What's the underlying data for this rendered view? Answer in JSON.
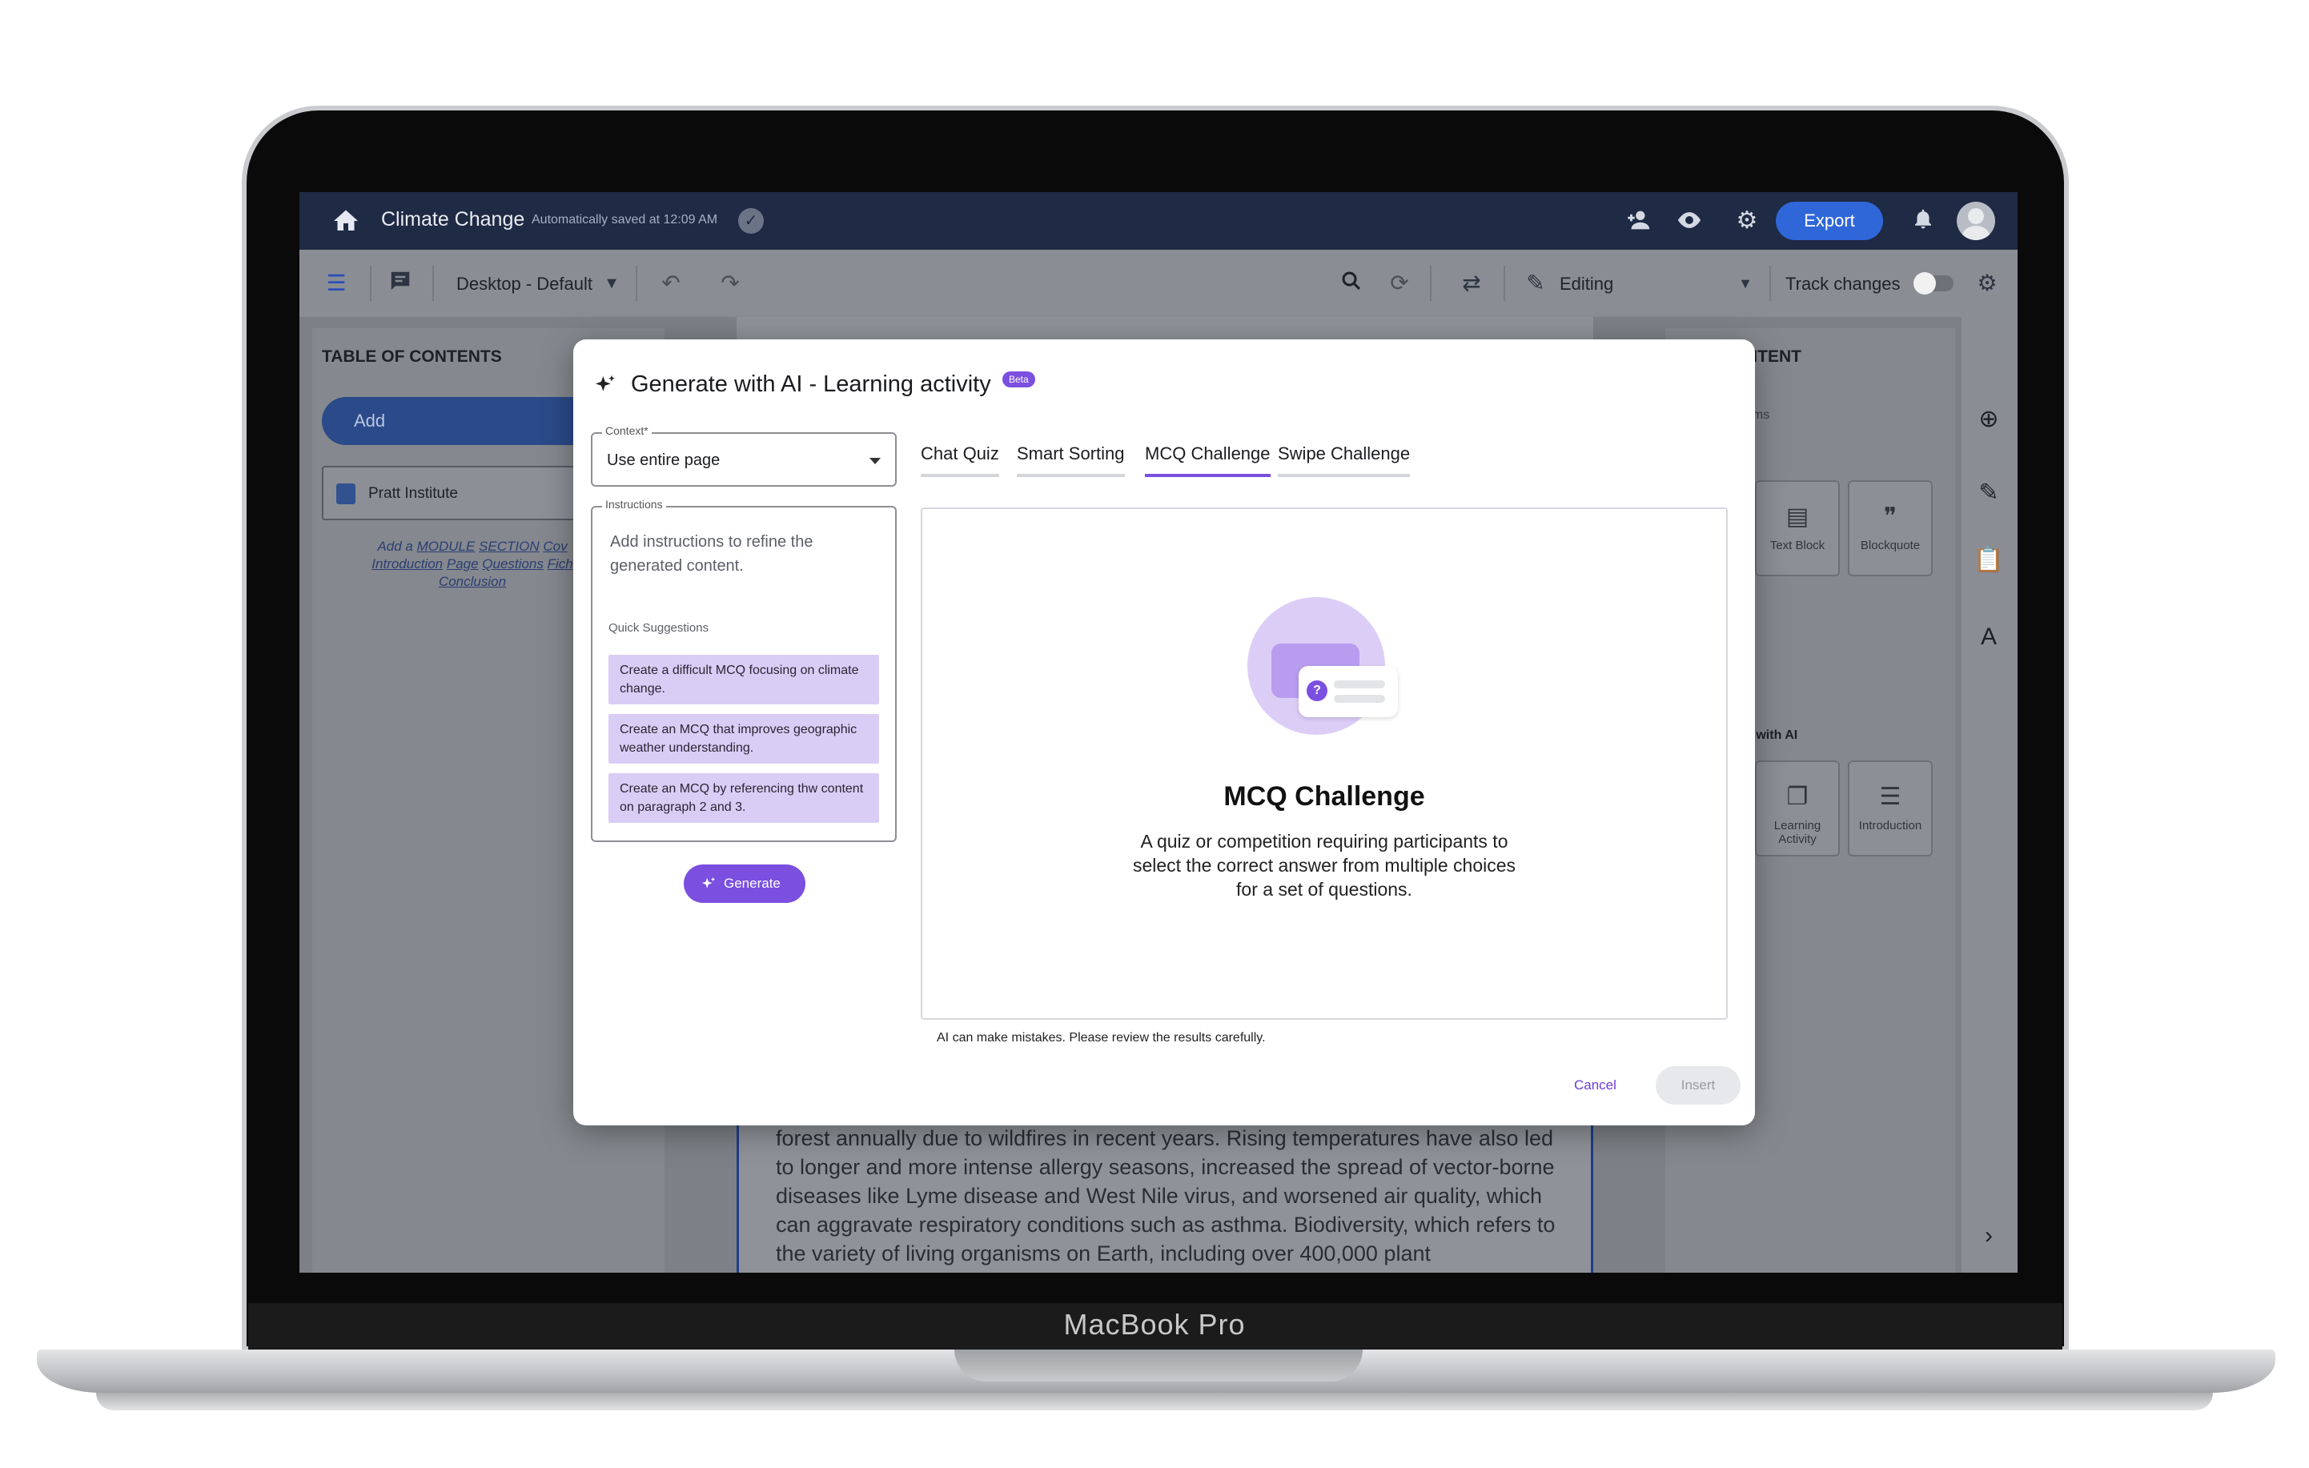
{
  "device": {
    "brand": "MacBook Pro"
  },
  "app": {
    "title": "Climate Change",
    "saved_status": "Automatically saved at 12:09 AM",
    "export_label": "Export"
  },
  "toolbar": {
    "view_mode": "Desktop - Default",
    "mode": "Editing",
    "track_changes_label": "Track changes"
  },
  "toc": {
    "heading": "TABLE OF CONTENTS",
    "add_label": "Add",
    "item_label": "Pratt Institute",
    "hint_prefix": "Add a",
    "hint_links": [
      "MODULE",
      "SECTION",
      "Cov",
      "Introduction",
      "Page",
      "Questions",
      "Fich",
      "Conclusion"
    ]
  },
  "document": {
    "visible_text": "Glacier National Park since 1850, and the U.S. has lost nearly 3 million acres of forest annually due to wildfires in recent years. Rising temperatures have also led to longer and more intense allergy seasons, increased the spread of vector-borne diseases like Lyme disease and West Nile virus, and worsened air quality, which can aggravate respiratory conditions such as asthma. Biodiversity, which refers to the variety of living organisms on Earth, including over 400,000 plant"
  },
  "right_panel": {
    "heading_partial": "NTENT",
    "search_placeholder_partial": "ems",
    "tiles_top": [
      "Text Block",
      "Blockquote"
    ],
    "ai_section_partial": "e with AI",
    "tiles_ai": [
      "Learning Activity",
      "Introduction"
    ]
  },
  "modal": {
    "title": "Generate with AI - Learning activity",
    "badge": "Beta",
    "context": {
      "label": "Context*",
      "value": "Use entire page"
    },
    "instructions": {
      "label": "Instructions",
      "placeholder": "Add instructions to refine the generated content.",
      "quick_suggestions_label": "Quick Suggestions",
      "suggestions": [
        "Create a difficult MCQ focusing on climate change.",
        "Create an MCQ that improves geographic weather understanding.",
        "Create an MCQ by referencing thw content on paragraph 2 and 3."
      ]
    },
    "generate_label": "Generate",
    "tabs": [
      "Chat Quiz",
      "Smart Sorting",
      "MCQ Challenge",
      "Swipe Challenge"
    ],
    "active_tab": "MCQ Challenge",
    "preview": {
      "title": "MCQ Challenge",
      "description": "A quiz or competition requiring participants to select the correct answer from multiple choices for a set of questions.",
      "icon_glyph": "?"
    },
    "disclaimer": "AI can make mistakes. Please review the results carefully.",
    "cancel_label": "Cancel",
    "insert_label": "Insert"
  },
  "colors": {
    "accent": "#7b4fe0",
    "topbar": "#1f2a44",
    "export": "#2f67d8",
    "suggestion_bg": "#d9cdf6"
  },
  "icons": {
    "topbar": [
      "home-icon",
      "check-circle-icon",
      "add-person-icon",
      "eye-icon",
      "gear-icon",
      "bell-icon",
      "avatar"
    ],
    "toolbar": [
      "list-icon",
      "comment-icon",
      "undo-icon",
      "redo-icon",
      "search-icon",
      "search-replace-icon",
      "sync-icon",
      "pencil-icon",
      "settings-icon"
    ],
    "rail": [
      "add-circle-icon",
      "pencil-icon",
      "clipboard-icon",
      "spellcheck-icon"
    ]
  }
}
